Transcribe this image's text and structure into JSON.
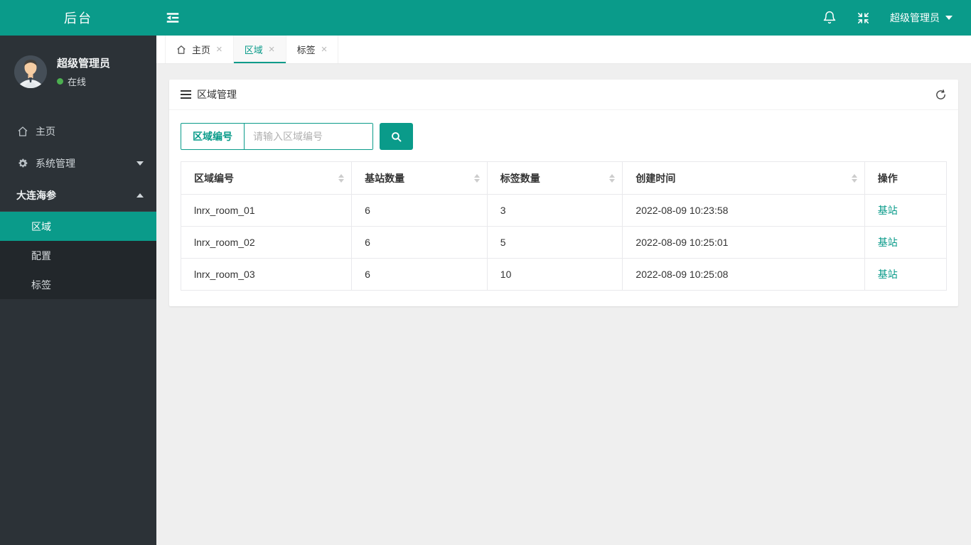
{
  "colors": {
    "primary": "#0a9b8a",
    "sidebar_bg": "#2c3237",
    "submenu_bg": "#22272b",
    "page_bg": "#efefef",
    "online_green": "#4caf50",
    "link": "#0a9b8a"
  },
  "navbar": {
    "logo": "后台",
    "icons": [
      "menu-toggle-icon",
      "bell-icon",
      "compress-icon"
    ],
    "user_menu": "超级管理员"
  },
  "sidebar": {
    "user": {
      "name": "超级管理员",
      "status": "在线"
    },
    "items": [
      {
        "label": "主页",
        "icon": "home-icon"
      },
      {
        "label": "系统管理",
        "icon": "gear-icon",
        "caret": "down"
      },
      {
        "label": "大连海参",
        "caret": "up",
        "children": [
          {
            "label": "区域",
            "active": true
          },
          {
            "label": "配置",
            "active": false
          },
          {
            "label": "标签",
            "active": false
          }
        ]
      }
    ]
  },
  "tabs": [
    {
      "label": "主页",
      "icon": "home-icon",
      "close": "×",
      "active": false
    },
    {
      "label": "区域",
      "close": "×",
      "active": true
    },
    {
      "label": "标签",
      "close": "×",
      "active": false
    }
  ],
  "panel": {
    "title": "区域管理",
    "header_icons": [
      "list-icon",
      "refresh-icon"
    ],
    "search": {
      "label": "区域编号",
      "placeholder": "请输入区域编号",
      "value": "",
      "button_icon": "search-icon"
    }
  },
  "table": {
    "columns": [
      {
        "label": "区域编号",
        "sortable": true,
        "width": "22.3%"
      },
      {
        "label": "基站数量",
        "sortable": true,
        "width": "17.7%"
      },
      {
        "label": "标签数量",
        "sortable": true,
        "width": "17.7%"
      },
      {
        "label": "创建时间",
        "sortable": true,
        "width": "31.6%"
      },
      {
        "label": "操作",
        "sortable": false,
        "width": "10.7%"
      }
    ],
    "rows": [
      {
        "area_id": "lnrx_room_01",
        "base_stations": "6",
        "tags": "3",
        "created_at": "2022-08-09 10:23:58",
        "action": "基站"
      },
      {
        "area_id": "lnrx_room_02",
        "base_stations": "6",
        "tags": "5",
        "created_at": "2022-08-09 10:25:01",
        "action": "基站"
      },
      {
        "area_id": "lnrx_room_03",
        "base_stations": "6",
        "tags": "10",
        "created_at": "2022-08-09 10:25:08",
        "action": "基站"
      }
    ]
  }
}
